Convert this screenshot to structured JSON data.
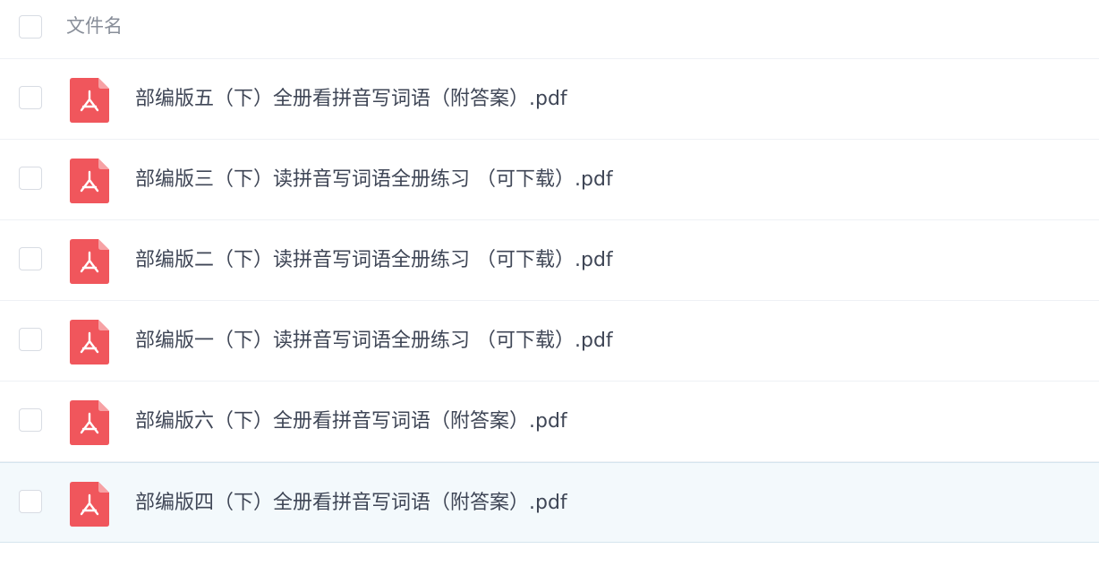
{
  "header": {
    "column_label": "文件名"
  },
  "files": [
    {
      "name": "部编版五（下）全册看拼音写词语（附答案）.pdf",
      "icon": "pdf-file-icon",
      "selected": false
    },
    {
      "name": "部编版三（下）读拼音写词语全册练习 （可下载）.pdf",
      "icon": "pdf-file-icon",
      "selected": false
    },
    {
      "name": "部编版二（下）读拼音写词语全册练习 （可下载）.pdf",
      "icon": "pdf-file-icon",
      "selected": false
    },
    {
      "name": "部编版一（下）读拼音写词语全册练习 （可下载）.pdf",
      "icon": "pdf-file-icon",
      "selected": false
    },
    {
      "name": "部编版六（下）全册看拼音写词语（附答案）.pdf",
      "icon": "pdf-file-icon",
      "selected": false
    },
    {
      "name": "部编版四（下）全册看拼音写词语（附答案）.pdf",
      "icon": "pdf-file-icon",
      "selected": false
    }
  ],
  "colors": {
    "pdf_icon": "#f0565c",
    "highlight_row": "#f3f9fc",
    "text": "#3f4656",
    "header_text": "#888e99"
  }
}
